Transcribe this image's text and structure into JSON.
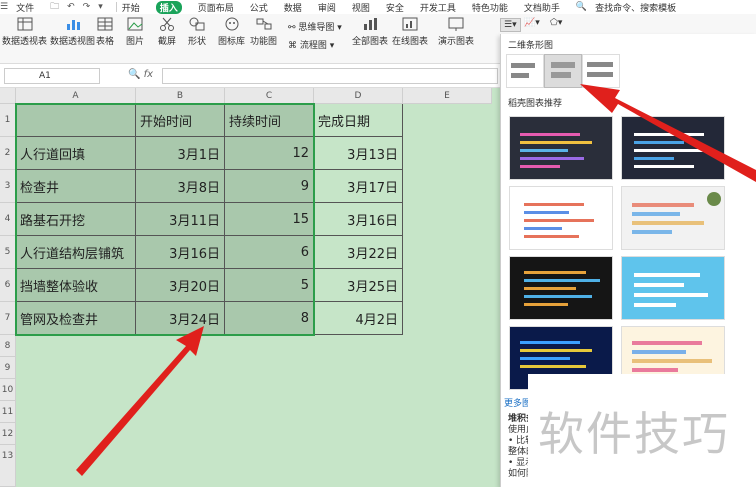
{
  "menu": {
    "items": [
      "文件",
      "开始",
      "插入",
      "页面布局",
      "公式",
      "数据",
      "审阅",
      "视图",
      "安全",
      "开发工具",
      "特色功能",
      "文档助手"
    ],
    "active": "插入",
    "search_placeholder": "查找命令、搜索模板"
  },
  "ribbon": {
    "buttons": [
      "数据透视表",
      "数据透视图",
      "表格",
      "图片",
      "截屏",
      "形状",
      "图标库",
      "功能图",
      "全部图表",
      "在线图表",
      "演示图表"
    ],
    "small_buttons": [
      "思维导图",
      "流程图"
    ]
  },
  "formula_bar": {
    "cell_ref": "A1",
    "fx": "fx"
  },
  "columns": [
    "A",
    "B",
    "C",
    "D",
    "E"
  ],
  "rows": [
    "1",
    "2",
    "3",
    "4",
    "5",
    "6",
    "7",
    "8",
    "9",
    "10",
    "11",
    "12",
    "13"
  ],
  "table": {
    "headers": [
      "",
      "开始时间",
      "持续时间",
      "完成日期"
    ],
    "rows": [
      [
        "人行道回填",
        "3月1日",
        "12",
        "3月13日"
      ],
      [
        "检查井",
        "3月8日",
        "9",
        "3月17日"
      ],
      [
        "路基石开挖",
        "3月11日",
        "15",
        "3月16日"
      ],
      [
        "人行道结构层铺筑",
        "3月16日",
        "6",
        "3月22日"
      ],
      [
        "挡墙整体验收",
        "3月20日",
        "5",
        "3月25日"
      ],
      [
        "管网及检查井",
        "3月24日",
        "8",
        "4月2日"
      ]
    ]
  },
  "chart_panel": {
    "title": "二维条形图",
    "section": "稻壳图表推荐",
    "more_link": "更多图",
    "desc_title": "堆积条",
    "desc_lines": [
      "使用此",
      "• 比较",
      "整体的",
      "• 显示",
      "如何随"
    ]
  },
  "watermark": "软件技巧",
  "colors": {
    "grid_bg": "#c6e5c8",
    "selection": "#a9c8ac",
    "accent": "#1aa35a",
    "arrow": "#e0201c"
  }
}
